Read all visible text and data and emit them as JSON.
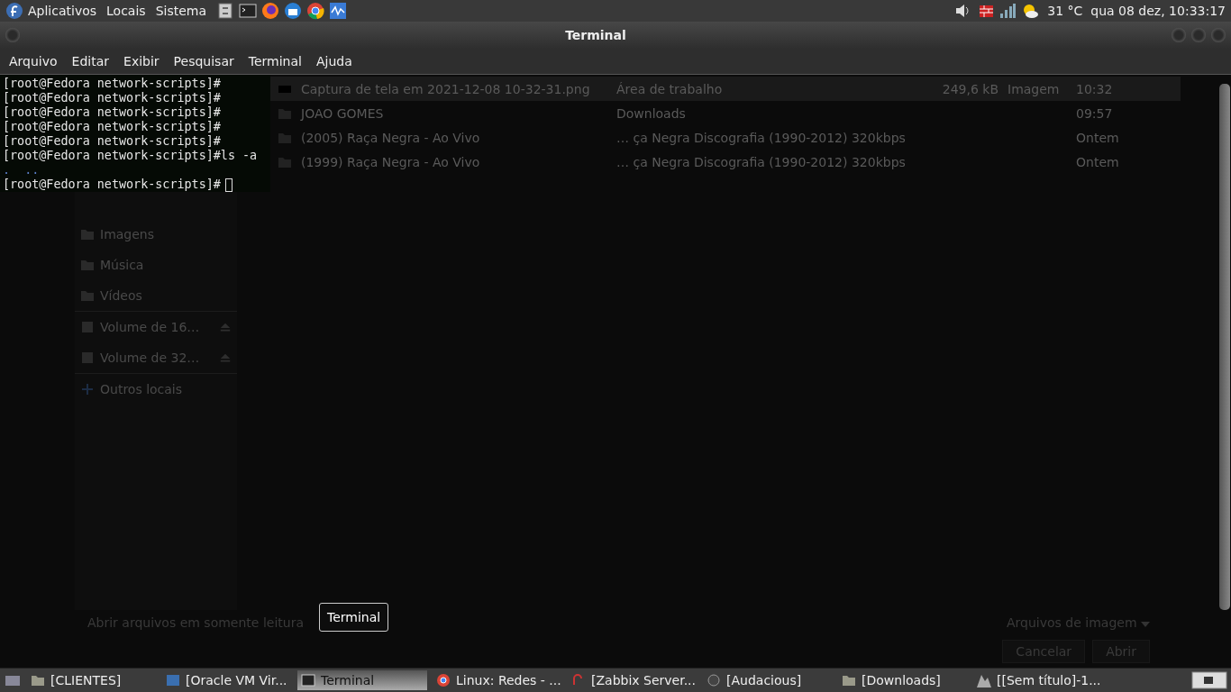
{
  "top_panel": {
    "menus": [
      "Aplicativos",
      "Locais",
      "Sistema"
    ],
    "temperature": "31 °C",
    "clock": "qua 08 dez, 10:33:17"
  },
  "window": {
    "title": "Terminal",
    "menu": [
      "Arquivo",
      "Editar",
      "Exibir",
      "Pesquisar",
      "Terminal",
      "Ajuda"
    ]
  },
  "terminal": {
    "lines": [
      {
        "kind": "prompt",
        "prompt": "[root@Fedora network-scripts]#"
      },
      {
        "kind": "prompt",
        "prompt": "[root@Fedora network-scripts]#"
      },
      {
        "kind": "prompt",
        "prompt": "[root@Fedora network-scripts]#"
      },
      {
        "kind": "prompt",
        "prompt": "[root@Fedora network-scripts]#"
      },
      {
        "kind": "prompt",
        "prompt": "[root@Fedora network-scripts]#"
      },
      {
        "kind": "prompt",
        "prompt": "[root@Fedora network-scripts]#",
        "command": "ls -a"
      },
      {
        "kind": "output",
        "text": ".  .."
      },
      {
        "kind": "cursor",
        "prompt": "[root@Fedora network-scripts]#"
      }
    ]
  },
  "background_dialog": {
    "sidebar": [
      {
        "label": "Imagens",
        "kind": "places"
      },
      {
        "label": "Música",
        "kind": "places"
      },
      {
        "label": "Vídeos",
        "kind": "places"
      },
      {
        "label": "Volume de 16…",
        "kind": "volume"
      },
      {
        "label": "Volume de 32…",
        "kind": "volume"
      },
      {
        "label": "Outros locais",
        "kind": "other"
      }
    ],
    "files": [
      {
        "name": "Captura de tela em 2021-12-08 10-32-31.png",
        "location": "Área de trabalho",
        "size": "249,6 kB",
        "type": "Imagem",
        "modified": "10:32",
        "kind": "image",
        "selected": true
      },
      {
        "name": "JOAO GOMES",
        "location": "Downloads",
        "modified": "09:57",
        "kind": "folder",
        "selected": false
      },
      {
        "name": "(2005) Raça Negra - Ao Vivo",
        "location": "… ça Negra Discografia (1990-2012) 320kbps",
        "modified": "Ontem",
        "kind": "folder",
        "selected": false
      },
      {
        "name": "(1999) Raça Negra - Ao Vivo",
        "location": "… ça Negra Discografia (1990-2012) 320kbps",
        "modified": "Ontem",
        "kind": "folder",
        "selected": false
      }
    ],
    "read_only_option": "Abrir arquivos em somente leitura",
    "filter": "Arquivos de imagem",
    "buttons": [
      "Cancelar",
      "Abrir"
    ]
  },
  "tooltip": "Terminal",
  "taskbar": [
    {
      "label": "[CLIENTES]",
      "kind": "folder",
      "selected": false
    },
    {
      "label": "[Oracle VM Vir...",
      "kind": "vbox",
      "selected": false
    },
    {
      "label": "Terminal",
      "kind": "terminal",
      "selected": true
    },
    {
      "label": "Linux: Redes - ...",
      "kind": "chrome",
      "selected": false
    },
    {
      "label": "[Zabbix Server...",
      "kind": "zabbix",
      "selected": false
    },
    {
      "label": "[Audacious]",
      "kind": "audio",
      "selected": false
    },
    {
      "label": "[Downloads]",
      "kind": "folder",
      "selected": false
    },
    {
      "label": "[[Sem título]-1...",
      "kind": "image",
      "selected": false
    }
  ]
}
